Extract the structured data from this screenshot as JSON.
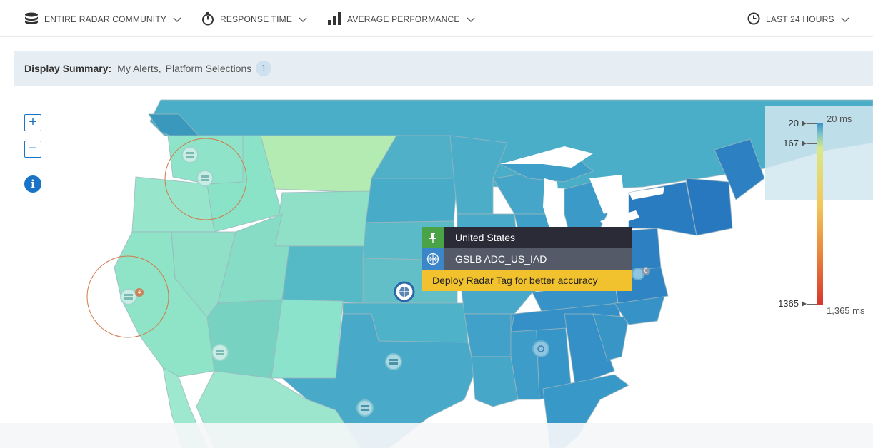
{
  "toolbar": {
    "community": {
      "label": "ENTIRE RADAR COMMUNITY",
      "icon": "database-icon"
    },
    "metric": {
      "label": "RESPONSE TIME",
      "icon": "stopwatch-icon"
    },
    "performance": {
      "label": "AVERAGE PERFORMANCE",
      "icon": "bar-chart-icon"
    },
    "timerange": {
      "label": "LAST 24 HOURS",
      "icon": "clock-icon"
    }
  },
  "summary": {
    "label": "Display Summary:",
    "items": [
      "My Alerts,",
      "Platform Selections"
    ],
    "count": "1"
  },
  "map_controls": {
    "zoom_in": "+",
    "zoom_out": "−",
    "info": "i"
  },
  "legend": {
    "top_value": "20",
    "top_ms": "20 ms",
    "second_value": "167",
    "bottom_value": "1365",
    "bottom_ms": "1,365 ms",
    "colors": [
      "#3a8fc7",
      "#d9e88a",
      "#f2c85a",
      "#d6352e"
    ]
  },
  "tooltip": {
    "location": "United States",
    "location_icon": "pin-icon",
    "server": "GSLB ADC_US_IAD",
    "server_icon": "globe-node-icon",
    "hint": "Deploy Radar Tag for better accuracy"
  },
  "markers": {
    "cluster_west_count": "4",
    "cluster_east_count": "6"
  },
  "colors": {
    "accent": "#1a73c7",
    "west_region": "#8fe0c6",
    "central_region": "#4fb3c7",
    "east_region": "#2f7fc3"
  }
}
